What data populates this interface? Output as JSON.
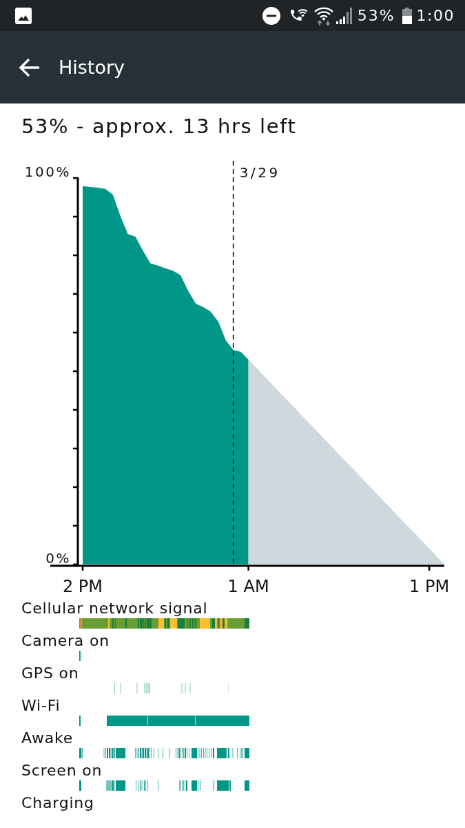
{
  "status_bar": {
    "battery": "53%",
    "time": "1:00"
  },
  "app_bar": {
    "title": "History"
  },
  "summary": "53% - approx. 13 hrs left",
  "chart": {
    "date_marker": "3/29",
    "chart_data": {
      "type": "area",
      "categories": [
        "2 PM",
        null,
        null,
        null,
        null,
        null,
        null,
        null,
        null,
        null,
        null,
        null,
        null,
        null,
        null,
        null,
        null,
        null,
        null,
        null,
        null,
        null,
        "1 AM",
        null,
        null,
        null,
        null,
        null,
        null,
        null,
        null,
        null,
        null,
        null,
        null,
        null,
        null,
        null,
        null,
        null,
        null,
        null,
        null,
        null,
        null,
        null,
        "1 PM",
        null,
        null
      ],
      "series": [
        {
          "color": "#009688",
          "values": [
            97.9,
            97.7,
            97.5,
            97.2,
            95.7,
            90.2,
            85.5,
            84.8,
            81.2,
            77.9,
            77.3,
            76.6,
            76.0,
            74.8,
            70.8,
            67.5,
            66.6,
            65.4,
            62.8,
            58.0,
            55.5,
            55.0,
            53,
            null,
            null,
            null,
            null,
            null,
            null,
            null,
            null,
            null,
            null,
            null,
            null,
            null,
            null,
            null,
            null,
            null,
            null,
            null,
            null,
            null,
            null,
            null,
            null,
            null,
            null
          ]
        },
        {
          "color": "#cfd8dc",
          "values": [
            null,
            null,
            null,
            null,
            null,
            null,
            null,
            null,
            null,
            null,
            null,
            null,
            null,
            null,
            null,
            null,
            null,
            null,
            null,
            null,
            null,
            null,
            53,
            51,
            48.9,
            46.9,
            44.8,
            42.8,
            40.8,
            38.7,
            36.7,
            34.7,
            32.6,
            30.6,
            28.5,
            26.5,
            24.5,
            22.4,
            20.4,
            18.3,
            16.3,
            14.3,
            12.2,
            10.2,
            8.2,
            6.1,
            4.1,
            2,
            0
          ]
        }
      ],
      "ylim": [
        0,
        100
      ],
      "yticks": [
        {
          "value": 0,
          "label": "0%"
        },
        {
          "value": 100,
          "label": "100%"
        }
      ]
    }
  },
  "events": [
    {
      "label": "Cellular network signal",
      "kind": "signal"
    },
    {
      "label": "Camera on",
      "kind": "camera"
    },
    {
      "label": "GPS on",
      "kind": "gps"
    },
    {
      "label": "Wi-Fi",
      "kind": "wifi"
    },
    {
      "label": "Awake",
      "kind": "awake"
    },
    {
      "label": "Screen on",
      "kind": "screen"
    },
    {
      "label": "Charging",
      "kind": "charging"
    }
  ]
}
